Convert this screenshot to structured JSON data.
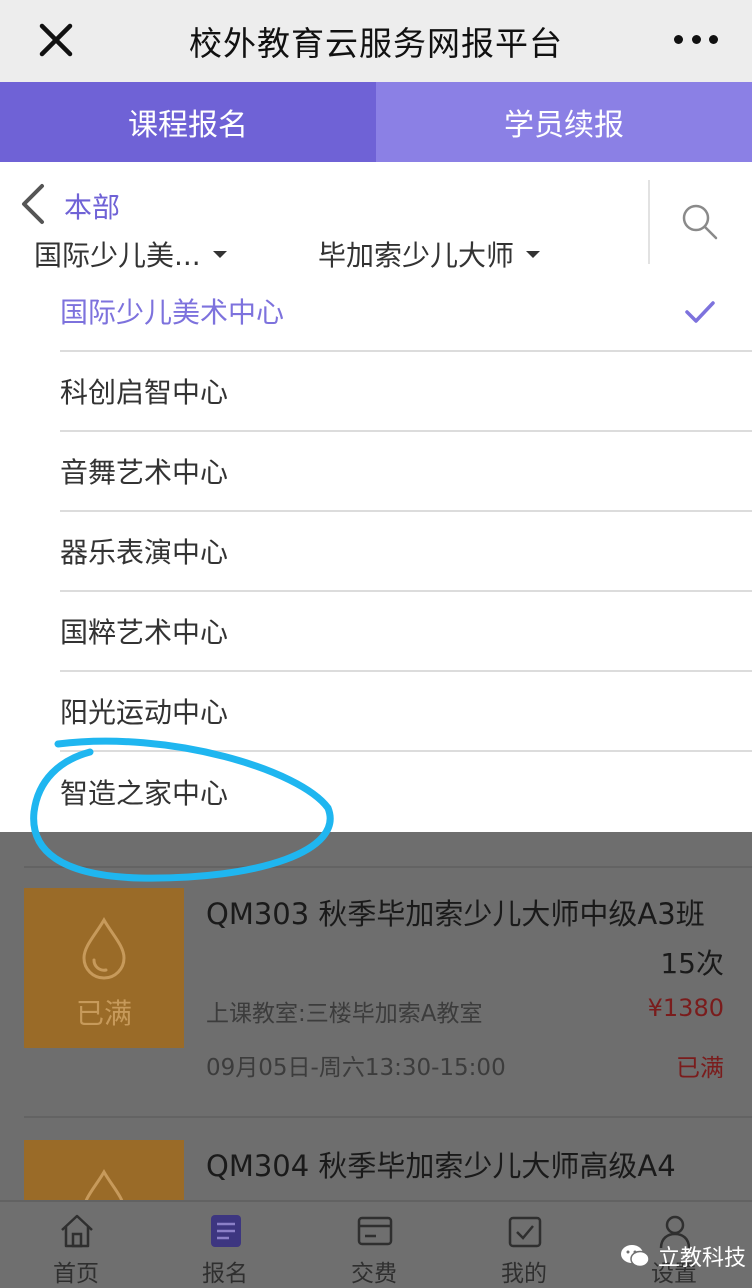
{
  "header": {
    "title": "校外教育云服务网报平台"
  },
  "tabs": [
    {
      "label": "课程报名"
    },
    {
      "label": "学员续报"
    }
  ],
  "filter": {
    "back_label": "本部",
    "dropdown_center": "国际少儿美...",
    "dropdown_course": "毕加索少儿大师"
  },
  "center_list": [
    {
      "label": "国际少儿美术中心"
    },
    {
      "label": "科创启智中心"
    },
    {
      "label": "音舞艺术中心"
    },
    {
      "label": "器乐表演中心"
    },
    {
      "label": "国粹艺术中心"
    },
    {
      "label": "阳光运动中心"
    },
    {
      "label": "智造之家中心"
    }
  ],
  "courses": [
    {
      "badge": "已满",
      "title": "QM303 秋季毕加索少儿大师中级A3班",
      "count": "15次",
      "room": "上课教室:三楼毕加索A教室",
      "price": "¥1380",
      "time": "09月05日-周六13:30-15:00",
      "status": "已满"
    },
    {
      "title": "QM304 秋季毕加索少儿大师高级A4"
    }
  ],
  "bottom_tabs": [
    {
      "label": "首页"
    },
    {
      "label": "报名"
    },
    {
      "label": "交费"
    },
    {
      "label": "我的"
    },
    {
      "label": "设置"
    }
  ],
  "watermark": {
    "text": "立教科技"
  },
  "colors": {
    "accent": "#6f62d6",
    "tab_inactive": "#8b80e5",
    "selected_text": "#7d72dd",
    "annotation": "#1fb6f0"
  }
}
